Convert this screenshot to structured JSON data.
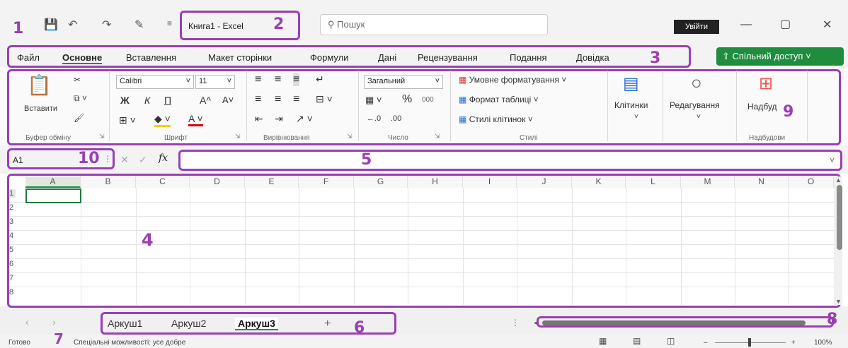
{
  "title": {
    "workbook": "Книга1",
    "app": "Excel",
    "separator": "-"
  },
  "search": {
    "placeholder": "Пошук"
  },
  "login": "Увійти",
  "window": {
    "minimize": "—",
    "maximize": "▢",
    "close": "✕"
  },
  "tabs": [
    "Файл",
    "Основне",
    "Вставлення",
    "Макет сторінки",
    "Формули",
    "Дані",
    "Рецензування",
    "Подання",
    "Довідка"
  ],
  "active_tab": "Основне",
  "share": "Спільний доступ",
  "ribbon": {
    "clipboard": {
      "paste": "Вставити",
      "label": "Буфер обміну"
    },
    "font": {
      "name": "Calibri",
      "size": "11",
      "bold": "Ж",
      "italic": "К",
      "underline": "П",
      "grow": "A^",
      "shrink": "A˅",
      "label": "Шрифт"
    },
    "alignment": {
      "label": "Вирівнювання"
    },
    "number": {
      "format": "Загальний",
      "percent": "%",
      "thousands": "000",
      "inc": "←.0",
      "dec": ".00",
      "label": "Число"
    },
    "styles": {
      "conditional": "Умовне форматування",
      "table": "Формат таблиці",
      "cell": "Стилі клітинок",
      "label": "Стилі"
    },
    "cells": {
      "label": "Клітинки"
    },
    "editing": {
      "label": "Редагування"
    },
    "addins": {
      "button": "Надбуд",
      "label": "Надбудови"
    }
  },
  "formula_bar": {
    "name_box": "A1",
    "cancel": "✕",
    "enter": "✓",
    "fx": "fx"
  },
  "columns": [
    "A",
    "B",
    "C",
    "D",
    "E",
    "F",
    "G",
    "H",
    "I",
    "J",
    "K",
    "L",
    "M",
    "N",
    "O"
  ],
  "rows": [
    "1",
    "2",
    "3",
    "4",
    "5",
    "6",
    "7",
    "8"
  ],
  "sheets": [
    "Аркуш1",
    "Аркуш2",
    "Аркуш3"
  ],
  "active_sheet": "Аркуш3",
  "add_sheet": "+",
  "status": {
    "ready": "Готово",
    "accessibility": "Спеціальні можливості: усе добре",
    "zoom": "100%",
    "minus": "–",
    "plus": "+"
  },
  "callouts": [
    "1",
    "2",
    "3",
    "4",
    "5",
    "6",
    "7",
    "8",
    "9",
    "10"
  ],
  "colors": {
    "accent": "#9b3fb3",
    "excel_green": "#1e8e3e"
  }
}
